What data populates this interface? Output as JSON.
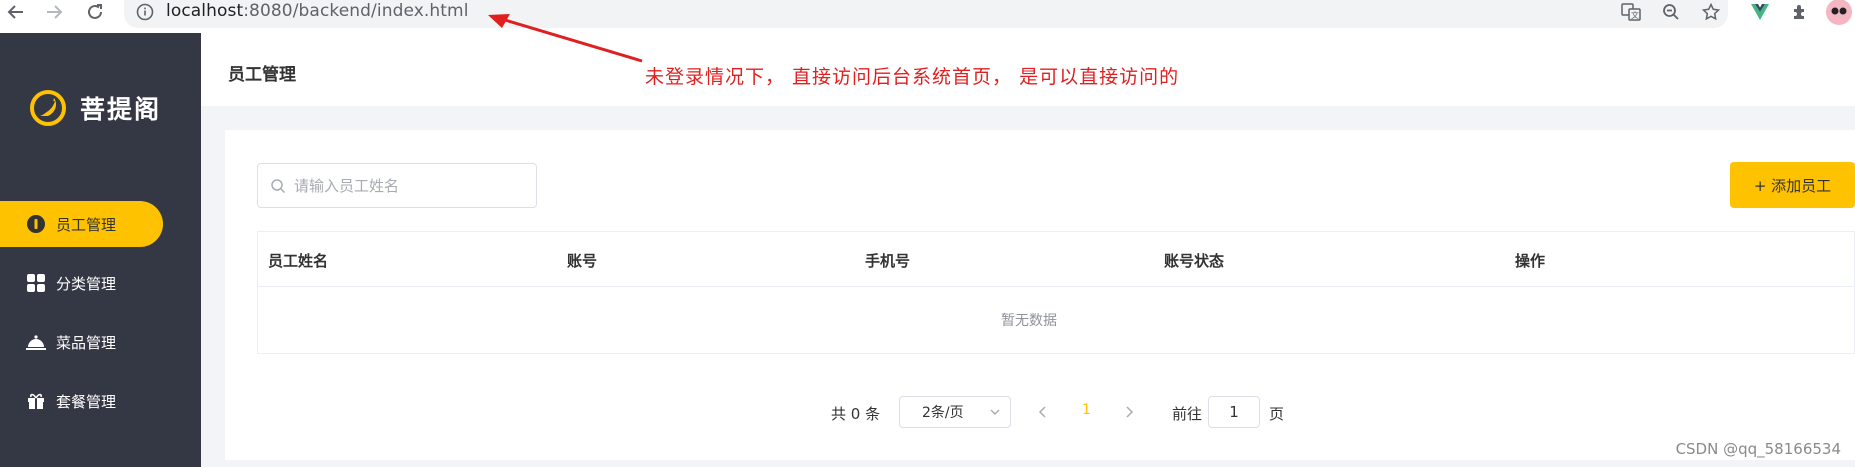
{
  "browser": {
    "url_host": "localhost",
    "url_rest": ":8080/backend/index.html"
  },
  "sidebar": {
    "logo_text": "菩提阁",
    "items": [
      {
        "label": "员工管理",
        "icon": "employee-icon",
        "active": true
      },
      {
        "label": "分类管理",
        "icon": "category-icon",
        "active": false
      },
      {
        "label": "菜品管理",
        "icon": "dish-icon",
        "active": false
      },
      {
        "label": "套餐管理",
        "icon": "combo-icon",
        "active": false
      }
    ]
  },
  "header": {
    "title": "员工管理"
  },
  "search": {
    "placeholder": "请输入员工姓名"
  },
  "toolbar": {
    "add_label": "+ 添加员工"
  },
  "table": {
    "columns": [
      "员工姓名",
      "账号",
      "手机号",
      "账号状态",
      "操作"
    ],
    "empty_text": "暂无数据"
  },
  "pagination": {
    "total": "共 0 条",
    "page_size": "2条/页",
    "current_page": "1",
    "goto_label": "前往",
    "goto_value": "1",
    "page_suffix": "页"
  },
  "annotation": {
    "text": "未登录情况下， 直接访问后台系统首页， 是可以直接访问的"
  },
  "watermark": "CSDN @qq_58166534",
  "colors": {
    "accent": "#ffc200",
    "sidebar": "#343744",
    "annotation": "#e02020"
  }
}
